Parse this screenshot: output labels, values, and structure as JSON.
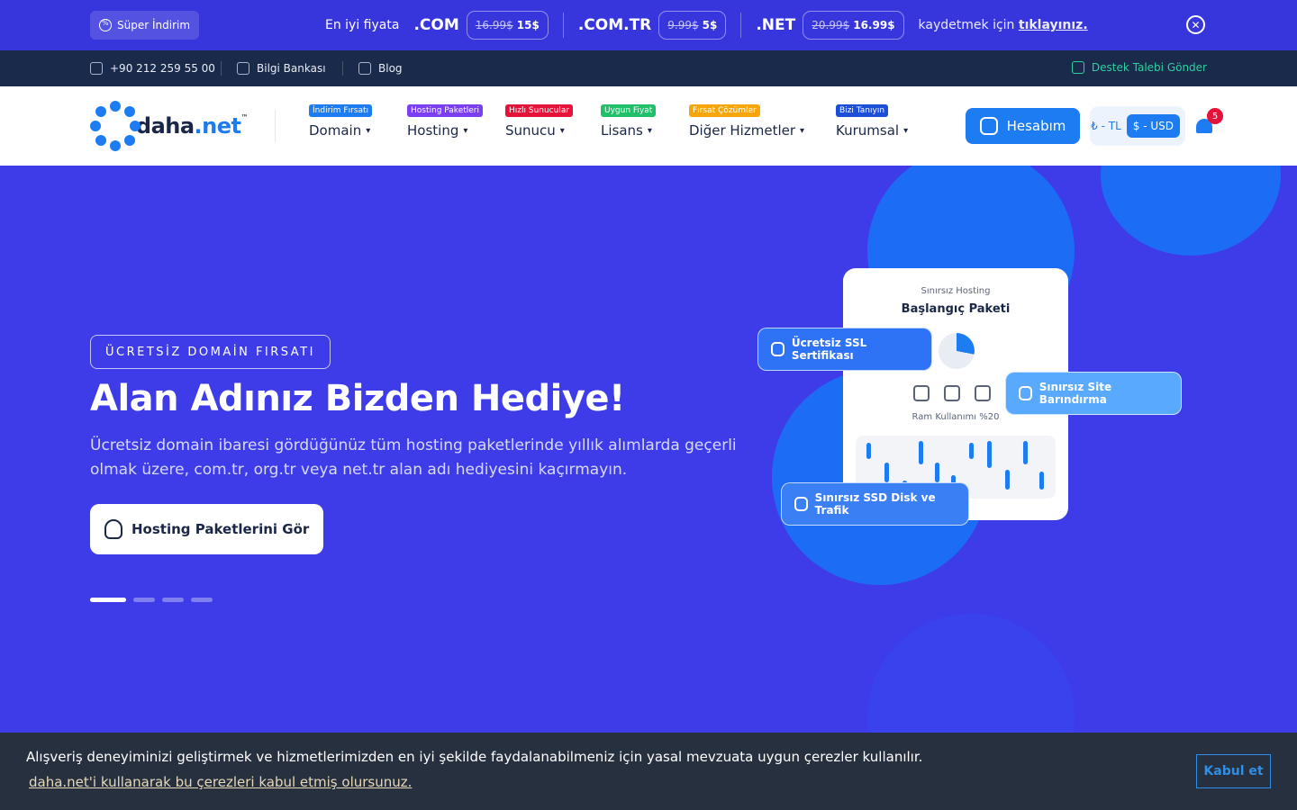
{
  "promo": {
    "badge": "Süper İndirim",
    "lead": "En iyi fiyata",
    "offers": [
      {
        "tld": ".COM",
        "old": "16.99$",
        "new": "15$"
      },
      {
        "tld": ".COM.TR",
        "old": "9.99$",
        "new": "5$"
      },
      {
        "tld": ".NET",
        "old": "20.99$",
        "new": "16.99$"
      }
    ],
    "tail_text": "kaydetmek için",
    "tail_link": "tıklayınız."
  },
  "contact": {
    "phone": "+90 212 259 55 00",
    "knowledge": "Bilgi Bankası",
    "blog": "Blog",
    "support": "Destek Talebi Gönder"
  },
  "header": {
    "logo_text_a": "daha",
    "logo_text_b": ".net",
    "logo_tm": "™",
    "menu": [
      {
        "tag": "İndirim Fırsatı",
        "tag_color": "#1d7cf2",
        "label": "Domain"
      },
      {
        "tag": "Hosting Paketleri",
        "tag_color": "#7b3ff2",
        "label": "Hosting"
      },
      {
        "tag": "Hızlı Sunucular",
        "tag_color": "#e5133a",
        "label": "Sunucu"
      },
      {
        "tag": "Uygun Fiyat",
        "tag_color": "#20c06a",
        "label": "Lisans"
      },
      {
        "tag": "Fırsat Çözümler",
        "tag_color": "#f6a609",
        "label": "Diğer Hizmetler"
      },
      {
        "tag": "Bizi Tanıyın",
        "tag_color": "#1d4ed8",
        "label": "Kurumsal"
      }
    ],
    "account_label": "Hesabım",
    "currency_tl": "₺ - TL",
    "currency_usd": "$ - USD",
    "notifications": "5"
  },
  "hero": {
    "kicker": "ÜCRETSİZ DOMAİN FIRSATI",
    "title": "Alan Adınız Bizden Hediye!",
    "description": "Ücretsiz domain ibaresi gördüğünüz tüm hosting paketlerinde yıllık alımlarda geçerli olmak üzere, com.tr, org.tr veya net.tr alan adı hediyesini kaçırmayın.",
    "cta": "Hosting Paketlerini Gör",
    "slides_total": 4,
    "slide_active": 1,
    "card_sub": "Sınırsız Hosting",
    "card_title": "Başlangıç Paketi",
    "ram_label": "Ram Kullanımı %20",
    "pill_ssl": "Ücretsiz SSL Sertifikası",
    "pill_sites": "Sınırsız Site Barındırma",
    "pill_disk": "Sınırsız SSD Disk ve Trafik"
  },
  "cookie": {
    "text": "Alışveriş deneyiminizi geliştirmek ve hizmetlerimizden en iyi şekilde faydalanabilmeniz için yasal mevzuata uygun çerezler kullanılır.",
    "link": "daha.net'i kullanarak bu çerezleri kabul etmiş olursunuz.",
    "accept": "Kabul et"
  },
  "colors": {
    "hero_bg": "#3d3ce8",
    "promo_bg": "#3736dc",
    "contact_bg": "#192a4a",
    "accent": "#1d7cf2",
    "support_green": "#2ed1a1",
    "cookie_bg": "#27303f"
  },
  "icons": [
    "discount-icon",
    "close-icon",
    "phone-icon",
    "knowledge-icon",
    "blog-icon",
    "support-icon",
    "user-icon",
    "bell-icon",
    "linux-icon",
    "shield-icon",
    "cpu-icon",
    "sites-icon",
    "disk-icon"
  ]
}
